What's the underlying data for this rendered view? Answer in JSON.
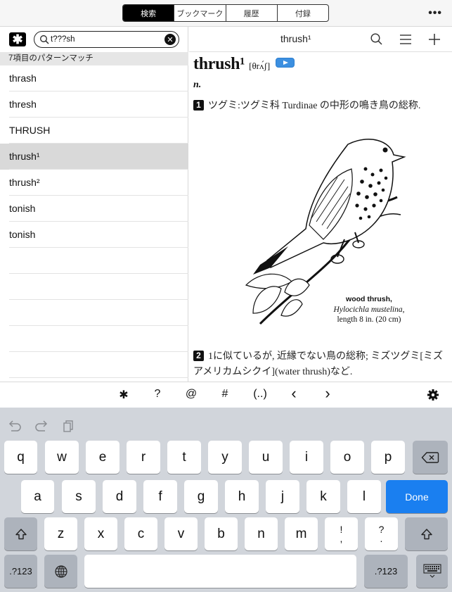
{
  "topbar": {
    "tabs": [
      {
        "label": "検索",
        "active": true
      },
      {
        "label": "ブックマーク",
        "active": false
      },
      {
        "label": "履歴",
        "active": false
      },
      {
        "label": "付録",
        "active": false
      }
    ],
    "more_label": "•••"
  },
  "search": {
    "wildcard_icon": "✱",
    "value": "t???sh",
    "placeholder": "",
    "clear_icon": "✕",
    "match_header": "7項目のパターンマッチ",
    "results": [
      {
        "label": "thrash",
        "selected": false
      },
      {
        "label": "thresh",
        "selected": false
      },
      {
        "label": "THRUSH",
        "selected": false
      },
      {
        "label": "thrush¹",
        "selected": true
      },
      {
        "label": "thrush²",
        "selected": false
      },
      {
        "label": "tonish",
        "selected": false
      },
      {
        "label": "tonish",
        "selected": false
      }
    ]
  },
  "entry": {
    "title": "thrush¹",
    "headword": "thrush¹",
    "pronunciation": "[θrʌ́ʃ]",
    "part_of_speech": "n.",
    "senses": [
      {
        "num": "1",
        "text": "ツグミ:ツグミ科 Turdinae の中形の鳴き鳥の総称."
      },
      {
        "num": "2",
        "text": "1に似ているが, 近縁でない鳥の総称; ミズツグミ[ミズアメリカムシクイ](water thrush)など."
      }
    ],
    "figure": {
      "caption_name": "wood thrush,",
      "caption_species": "Hylocichla mustelina,",
      "caption_size": "length 8 in. (20 cm)"
    }
  },
  "accessory": {
    "keys": [
      "✱",
      "?",
      "@",
      "#",
      "(..)",
      "‹",
      "›"
    ]
  },
  "keyboard": {
    "row1": [
      "q",
      "w",
      "e",
      "r",
      "t",
      "y",
      "u",
      "i",
      "o",
      "p"
    ],
    "row2": [
      "a",
      "s",
      "d",
      "f",
      "g",
      "h",
      "j",
      "k",
      "l"
    ],
    "row3": [
      "z",
      "x",
      "c",
      "v",
      "b",
      "n",
      "m"
    ],
    "punct1": {
      "top": "!",
      "bottom": ","
    },
    "punct2": {
      "top": "?",
      "bottom": "."
    },
    "done_label": "Done",
    "num_label": ".?123",
    "accent_color": "#1a7ff0"
  }
}
